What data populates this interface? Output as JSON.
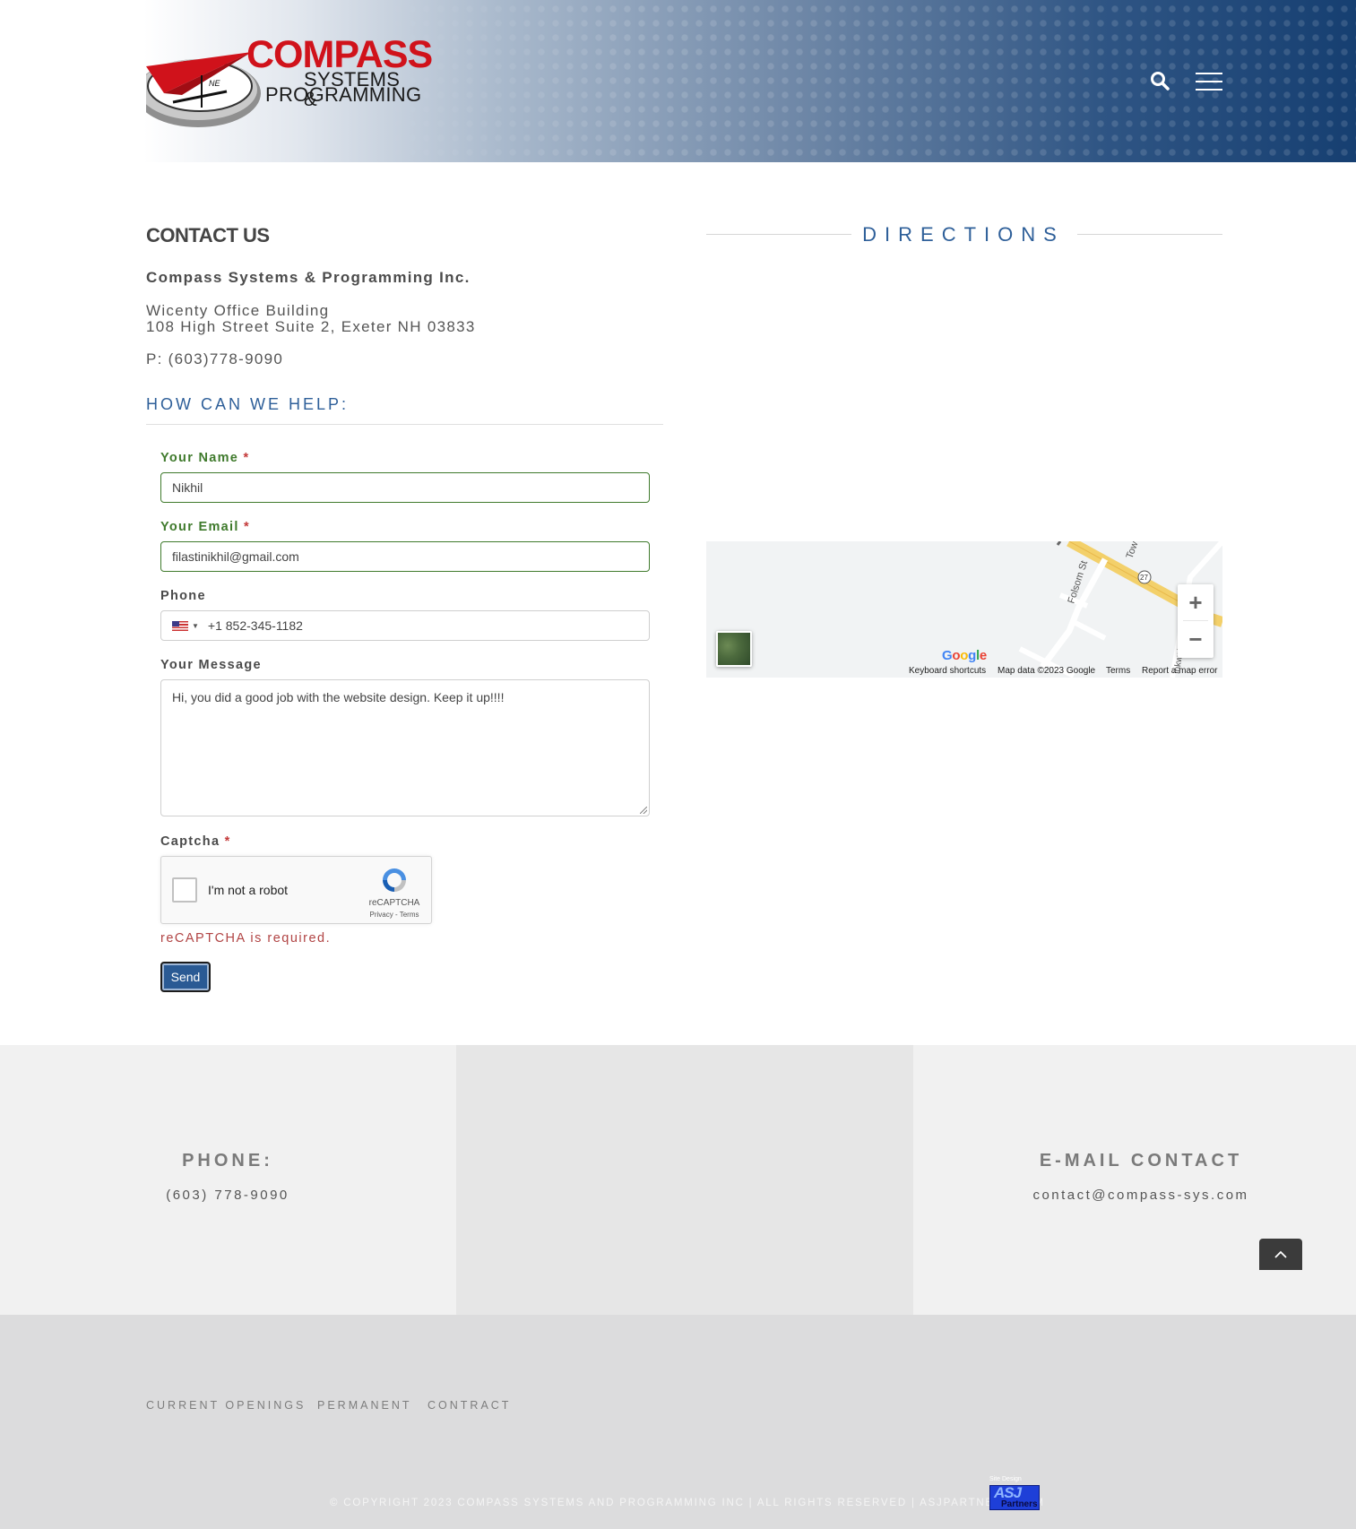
{
  "header": {
    "logo": {
      "line1": "COMPASS",
      "line2": "SYSTEMS &",
      "line3": "PROGRAMMING"
    },
    "search_icon": "search-icon",
    "menu_icon": "hamburger-menu-icon"
  },
  "contact": {
    "title": "CONTACT US",
    "company": "Compass Systems & Programming Inc.",
    "address_line1": "Wicenty Office Building",
    "address_line2": "108 High Street Suite 2, Exeter NH 03833",
    "phone": "P: (603)778-9090"
  },
  "help": {
    "title": "HOW CAN WE HELP:"
  },
  "form": {
    "name": {
      "label": "Your Name",
      "required": "*",
      "value": "Nikhil"
    },
    "email": {
      "label": "Your Email",
      "required": "*",
      "value": "filastinikhil@gmail.com"
    },
    "phone": {
      "label": "Phone",
      "value": "+1 852-345-1182",
      "flag_icon": "us-flag-icon"
    },
    "message": {
      "label": "Your Message",
      "value": "Hi, you did a good job with the website design. Keep it up!!!!"
    },
    "captcha": {
      "label": "Captcha",
      "required": "*",
      "checkbox_label": "I'm not a robot",
      "brand": "reCAPTCHA",
      "links": "Privacy - Terms",
      "error": "reCAPTCHA is required."
    },
    "send_label": "Send"
  },
  "directions": {
    "title": "DIRECTIONS",
    "map": {
      "street_1": "Folsom St",
      "street_2": "Tow",
      "street_3": "inkwate",
      "route": "27",
      "google": "Google",
      "keyboard_shortcuts": "Keyboard shortcuts",
      "map_data": "Map data ©2023 Google",
      "terms": "Terms",
      "report": "Report a map error",
      "zoom_in": "+",
      "zoom_out": "−"
    }
  },
  "info_band": {
    "phone_title": "PHONE:",
    "phone_value": "(603) 778-9090",
    "email_title": "E-MAIL CONTACT",
    "email_value": "contact@compass-sys.com"
  },
  "footer": {
    "links": [
      "CURRENT OPENINGS",
      "PERMANENT",
      "CONTRACT"
    ],
    "copyright": "© COPYRIGHT 2023 COMPASS SYSTEMS AND PROGRAMMING INC | ALL RIGHTS RESERVED | ASJPARTNERS.COM",
    "badge_small": "Site Design",
    "badge_main": "ASJ",
    "badge_sub": "Partners"
  },
  "colors": {
    "accent_blue": "#2e5f99",
    "valid_green": "#3f7a2c",
    "error_red": "#b14444",
    "brand_red": "#d0121b"
  }
}
